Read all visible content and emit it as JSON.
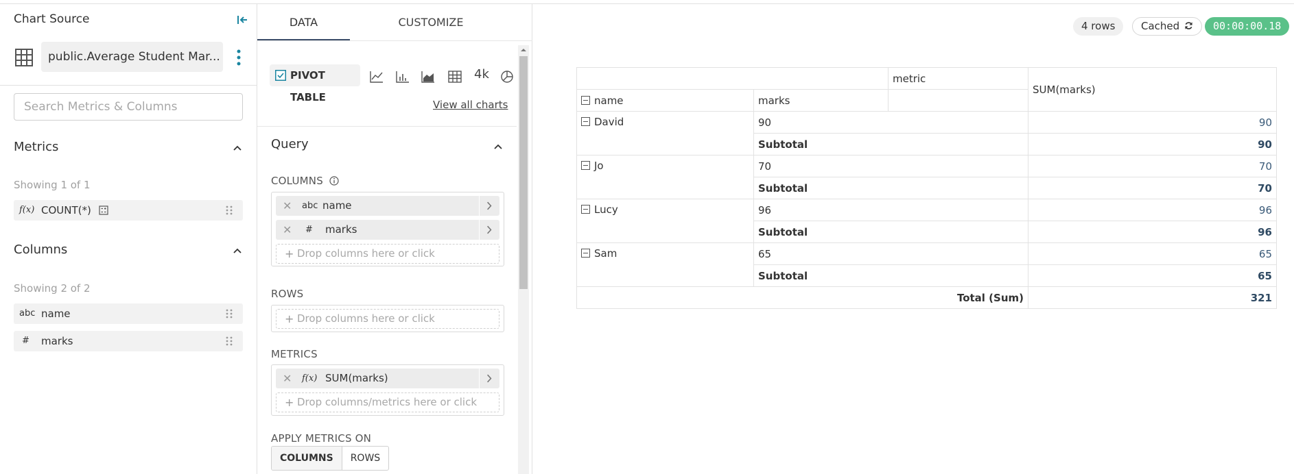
{
  "left_panel": {
    "title": "Chart Source",
    "dataset_name": "public.Average Student Mar...",
    "search_placeholder": "Search Metrics & Columns",
    "metrics": {
      "heading": "Metrics",
      "showing": "Showing 1 of 1",
      "items": [
        {
          "type": "f(x)",
          "label": "COUNT(*)"
        }
      ]
    },
    "columns": {
      "heading": "Columns",
      "showing": "Showing 2 of 2",
      "items": [
        {
          "type": "abc",
          "label": "name"
        },
        {
          "type": "#",
          "label": "marks"
        }
      ]
    }
  },
  "tabs": [
    {
      "label": "DATA",
      "active": true
    },
    {
      "label": "CUSTOMIZE",
      "active": false
    }
  ],
  "viz": {
    "selected": "PIVOT TABLE",
    "icons": [
      "line-chart-icon",
      "bar-chart-icon",
      "area-chart-icon",
      "table-icon",
      "big-number-icon",
      "pie-chart-icon"
    ],
    "big_number_label": "4k",
    "view_all": "View all charts"
  },
  "query": {
    "heading": "Query",
    "columns_label": "COLUMNS",
    "columns": [
      {
        "type": "abc",
        "label": "name"
      },
      {
        "type": "#",
        "label": "marks"
      }
    ],
    "columns_drop": "Drop columns here or click",
    "rows_label": "ROWS",
    "rows_drop": "Drop columns here or click",
    "metrics_label": "METRICS",
    "metrics": [
      {
        "type": "f(x)",
        "label": "SUM(marks)"
      }
    ],
    "metrics_drop": "Drop columns/metrics here or click",
    "apply_label": "APPLY METRICS ON",
    "apply_options": [
      "COLUMNS",
      "ROWS"
    ],
    "apply_selected": "COLUMNS"
  },
  "status": {
    "rows": "4 rows",
    "cached": "Cached",
    "time": "00:00:00.18",
    "time_color": "#5ac189"
  },
  "pivot": {
    "metric_header": "metric",
    "value_header": "SUM(marks)",
    "row_headers": [
      "name",
      "marks"
    ],
    "subtotal_label": "Subtotal",
    "total_label": "Total (Sum)",
    "total_value": "321",
    "rows": [
      {
        "name": "David",
        "marks": "90",
        "value": "90",
        "subtotal": "90"
      },
      {
        "name": "Jo",
        "marks": "70",
        "value": "70",
        "subtotal": "70"
      },
      {
        "name": "Lucy",
        "marks": "96",
        "value": "96",
        "subtotal": "96"
      },
      {
        "name": "Sam",
        "marks": "65",
        "value": "65",
        "subtotal": "65"
      }
    ]
  }
}
